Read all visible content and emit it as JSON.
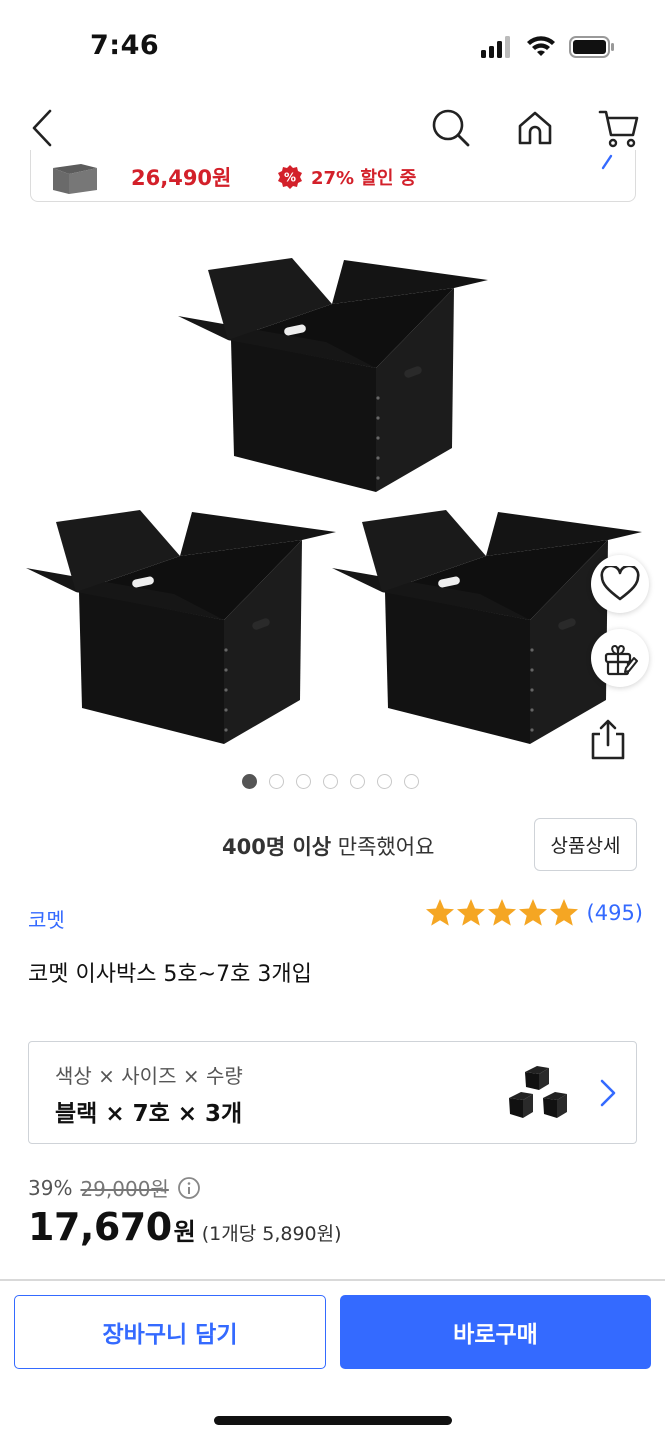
{
  "status_bar": {
    "time": "7:46",
    "icons": [
      "signal-icon",
      "wifi-icon",
      "battery-icon"
    ]
  },
  "nav": {
    "icons": [
      "back-icon",
      "search-icon",
      "home-icon",
      "cart-icon"
    ]
  },
  "promo": {
    "price": "26,490원",
    "badge_icon": "percent-badge-icon",
    "discount_text": "27% 할인 중"
  },
  "gallery": {
    "image_count": 7,
    "active_index": 0,
    "side_actions": [
      "heart-icon",
      "gift-icon",
      "share-icon"
    ]
  },
  "satisfaction": {
    "bold": "400명 이상",
    "rest": " 만족했어요"
  },
  "detail_button": "상품상세",
  "brand": "코멧",
  "rating": {
    "stars": 5,
    "count": "(495)"
  },
  "title": "코멧 이사박스 5호~7호 3개입",
  "option": {
    "label": "색상 × 사이즈 × 수량",
    "value": "블랙 × 7호 × 3개"
  },
  "price": {
    "discount_rate": "39%",
    "original": "29,000원",
    "sale": "17,670",
    "currency": "원",
    "per_unit": "(1개당 5,890원)"
  },
  "buttons": {
    "cart": "장바구니 담기",
    "buy": "바로구매"
  },
  "colors": {
    "accent": "#346aff",
    "sale_red": "#d3202a",
    "star": "#f5a623"
  }
}
